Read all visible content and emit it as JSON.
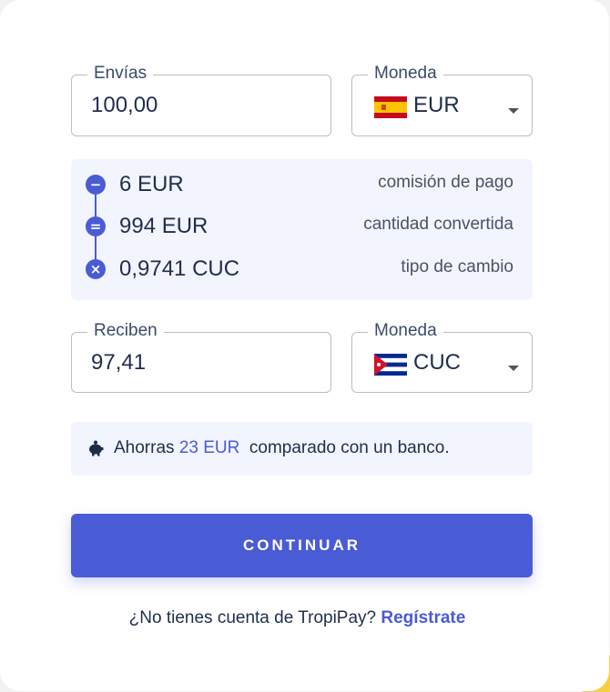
{
  "send": {
    "label": "Envías",
    "value": "100,00"
  },
  "send_currency": {
    "label": "Moneda",
    "value": "EUR",
    "flag_icon": "spain-flag-icon"
  },
  "breakdown": [
    {
      "icon_symbol": "−",
      "icon_name": "minus-icon",
      "amount": "6 EUR",
      "description": "comisión de pago"
    },
    {
      "icon_symbol": "=",
      "icon_name": "equals-icon",
      "amount": "994 EUR",
      "description": "cantidad convertida"
    },
    {
      "icon_symbol": "×",
      "icon_name": "times-icon",
      "amount": "0,9741 CUC",
      "description": "tipo de cambio"
    }
  ],
  "receive": {
    "label": "Reciben",
    "value": "97,41"
  },
  "receive_currency": {
    "label": "Moneda",
    "value": "CUC",
    "flag_icon": "cuba-flag-icon"
  },
  "savings": {
    "prefix": "Ahorras",
    "amount": "23 EUR",
    "suffix": "comparado con un banco."
  },
  "continue_label": "CONTINUAR",
  "signup": {
    "question": "¿No tienes cuenta de TropiPay?",
    "link": "Regístrate"
  },
  "colors": {
    "accent": "#4a5bd6",
    "panel": "#f3f5fe",
    "text": "#1f2d4d"
  }
}
